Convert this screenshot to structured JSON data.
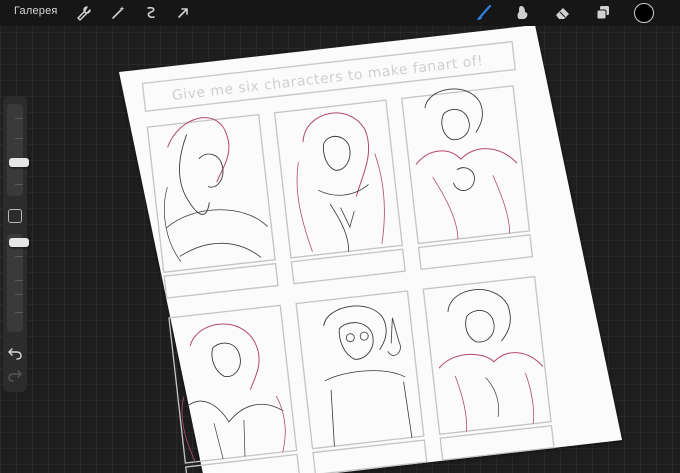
{
  "toolbar": {
    "gallery_label": "Галерея",
    "left_tools": [
      "wrench-icon",
      "magic-wand-icon",
      "selection-icon",
      "transform-arrow-icon"
    ],
    "right_tools": [
      "brush-icon",
      "smudge-icon",
      "eraser-icon",
      "layers-icon"
    ],
    "active_tool": "brush-icon",
    "accent_color": "#2f7fe0",
    "current_color": "#000000"
  },
  "sidebar": {
    "brush_size_level": 0.25,
    "opacity_level": 0.05,
    "undo": "undo-icon",
    "redo": "redo-icon"
  },
  "canvas": {
    "header_text": "Give me six characters to make fanart of!",
    "sketch_colors": {
      "line": "#3a3a3a",
      "rough": "#b24a6a",
      "frame": "#bdbdbd"
    }
  }
}
